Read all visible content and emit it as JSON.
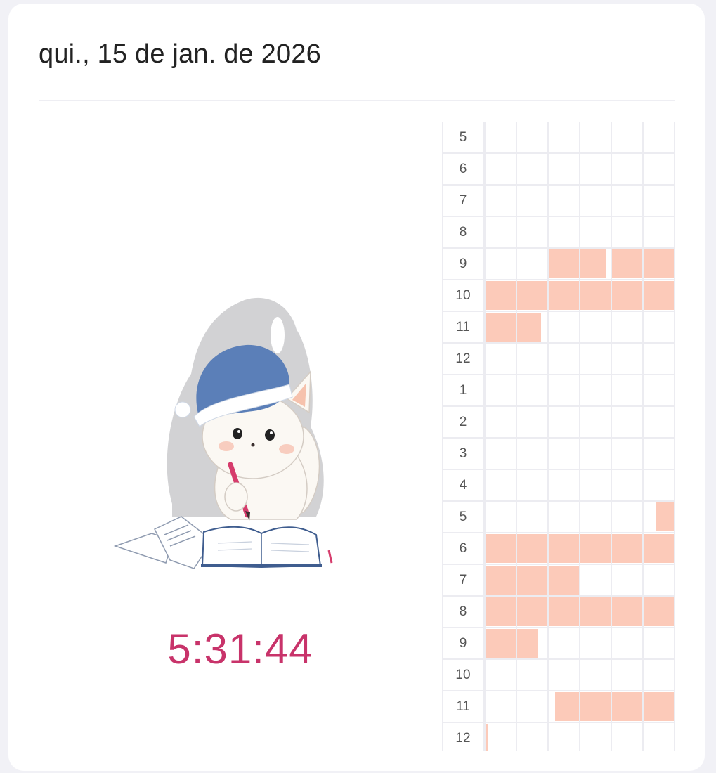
{
  "header": {
    "date": "qui., 15 de jan. de 2026"
  },
  "timer": {
    "elapsed": "5:31:44"
  },
  "mascot": {
    "icon": "cat-studying-illustration"
  },
  "colors": {
    "accent": "#c8336a",
    "fill": "#fccab9",
    "grid": "#ececf1"
  },
  "timeline": {
    "hours": [
      {
        "label": "5",
        "fills": [
          0,
          0,
          0,
          0,
          0,
          0
        ]
      },
      {
        "label": "6",
        "fills": [
          0,
          0,
          0,
          0,
          0,
          0
        ]
      },
      {
        "label": "7",
        "fills": [
          0,
          0,
          0,
          0,
          0,
          0
        ]
      },
      {
        "label": "8",
        "fills": [
          0,
          0,
          0,
          0,
          0,
          0
        ]
      },
      {
        "label": "9",
        "fills": [
          0,
          0,
          1,
          0.85,
          1,
          1
        ]
      },
      {
        "label": "10",
        "fills": [
          1,
          1,
          1,
          1,
          1,
          1
        ]
      },
      {
        "label": "11",
        "fills": [
          1,
          0.8,
          0,
          0,
          0,
          0
        ]
      },
      {
        "label": "12",
        "fills": [
          0,
          0,
          0,
          0,
          0,
          0
        ]
      },
      {
        "label": "1",
        "fills": [
          0,
          0,
          0,
          0,
          0,
          0
        ]
      },
      {
        "label": "2",
        "fills": [
          0,
          0,
          0,
          0,
          0,
          0
        ]
      },
      {
        "label": "3",
        "fills": [
          0,
          0,
          0,
          0,
          0,
          0
        ]
      },
      {
        "label": "4",
        "fills": [
          0,
          0,
          0,
          0,
          0,
          0
        ]
      },
      {
        "label": "5",
        "fills": [
          0,
          0,
          0,
          0,
          0,
          -0.6
        ]
      },
      {
        "label": "6",
        "fills": [
          1,
          1,
          1,
          1,
          1,
          1
        ]
      },
      {
        "label": "7",
        "fills": [
          1,
          1,
          1.05,
          0,
          0,
          0
        ]
      },
      {
        "label": "8",
        "fills": [
          1,
          1,
          1,
          1,
          1,
          1
        ]
      },
      {
        "label": "9",
        "fills": [
          1,
          0.7,
          0,
          0,
          0,
          0
        ]
      },
      {
        "label": "10",
        "fills": [
          0,
          0,
          0,
          0,
          0,
          0
        ]
      },
      {
        "label": "11",
        "fills": [
          0,
          0,
          -0.8,
          1,
          1,
          1
        ]
      },
      {
        "label": "12",
        "fills": [
          0.08,
          0,
          0,
          0,
          0,
          0
        ]
      }
    ]
  }
}
